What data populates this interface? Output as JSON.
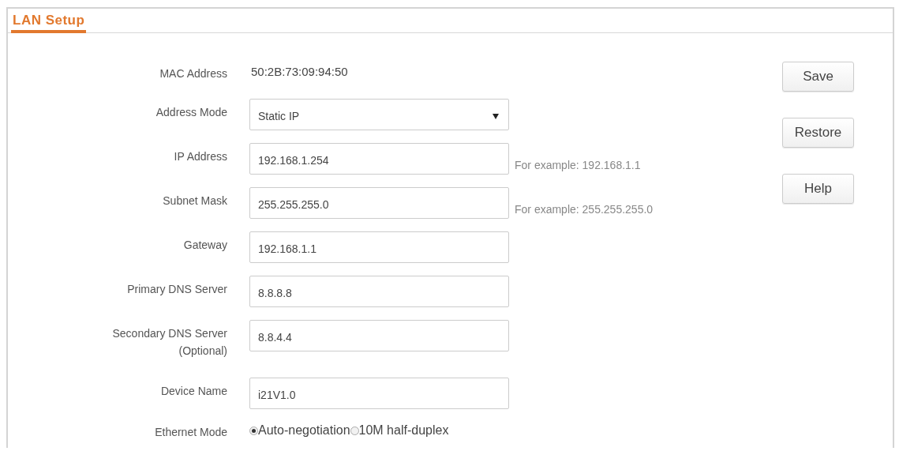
{
  "panel": {
    "title": "LAN Setup"
  },
  "fields": [
    {
      "kind": "static",
      "label": "MAC Address",
      "value": "50:2B:73:09:94:50"
    },
    {
      "kind": "select",
      "label": "Address Mode",
      "value": "Static IP"
    },
    {
      "kind": "input",
      "label": "IP Address",
      "value": "192.168.1.254",
      "hint": "For example: 192.168.1.1"
    },
    {
      "kind": "input",
      "label": "Subnet Mask",
      "value": "255.255.255.0",
      "hint": "For example: 255.255.255.0"
    },
    {
      "kind": "input",
      "label": "Gateway",
      "value": "192.168.1.1"
    },
    {
      "kind": "input",
      "label": "Primary DNS Server",
      "value": "8.8.8.8"
    },
    {
      "kind": "input",
      "label": "Secondary DNS Server",
      "label_note": "(Optional)",
      "value": "8.8.4.4"
    },
    {
      "kind": "input",
      "label": "Device Name",
      "value": "i21V1.0"
    },
    {
      "kind": "radio",
      "label": "Ethernet Mode",
      "options": [
        {
          "label": "Auto-negotiation",
          "selected": true
        },
        {
          "label": "10M half-duplex",
          "selected": false
        }
      ]
    }
  ],
  "buttons": [
    "Save",
    "Restore",
    "Help"
  ]
}
